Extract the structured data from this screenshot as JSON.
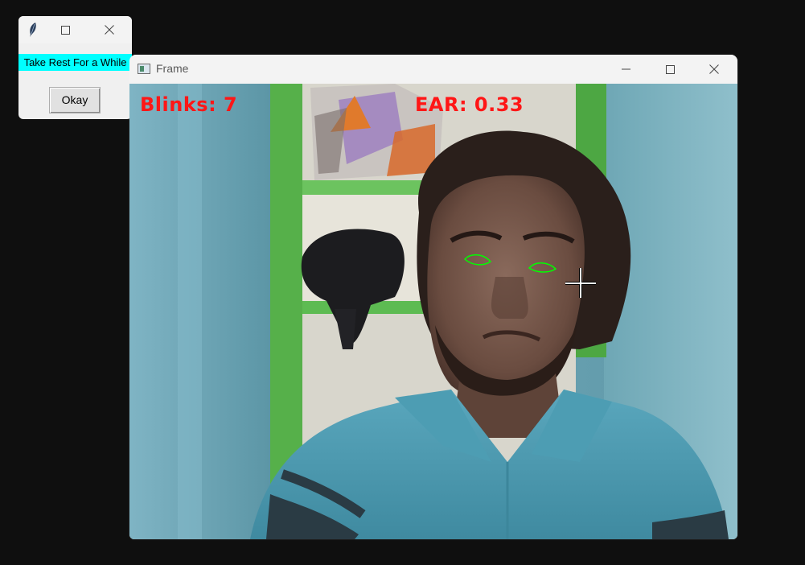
{
  "frame_window": {
    "title": "Frame",
    "controls": {
      "minimize": "minimize-icon",
      "maximize": "maximize-icon",
      "close": "close-icon"
    },
    "overlay": {
      "blinks_text": "Blinks: 7",
      "ear_text": "EAR: 0.33",
      "text_color": "#ff1616",
      "eye_contour_color": "#00ff00"
    },
    "video_icon": "webcam-feed"
  },
  "popup": {
    "icon": "feather-icon",
    "message": "Take Rest For a While",
    "message_bg": "#00ffff",
    "button_label": "Okay"
  },
  "cursor": "crosshair-icon"
}
